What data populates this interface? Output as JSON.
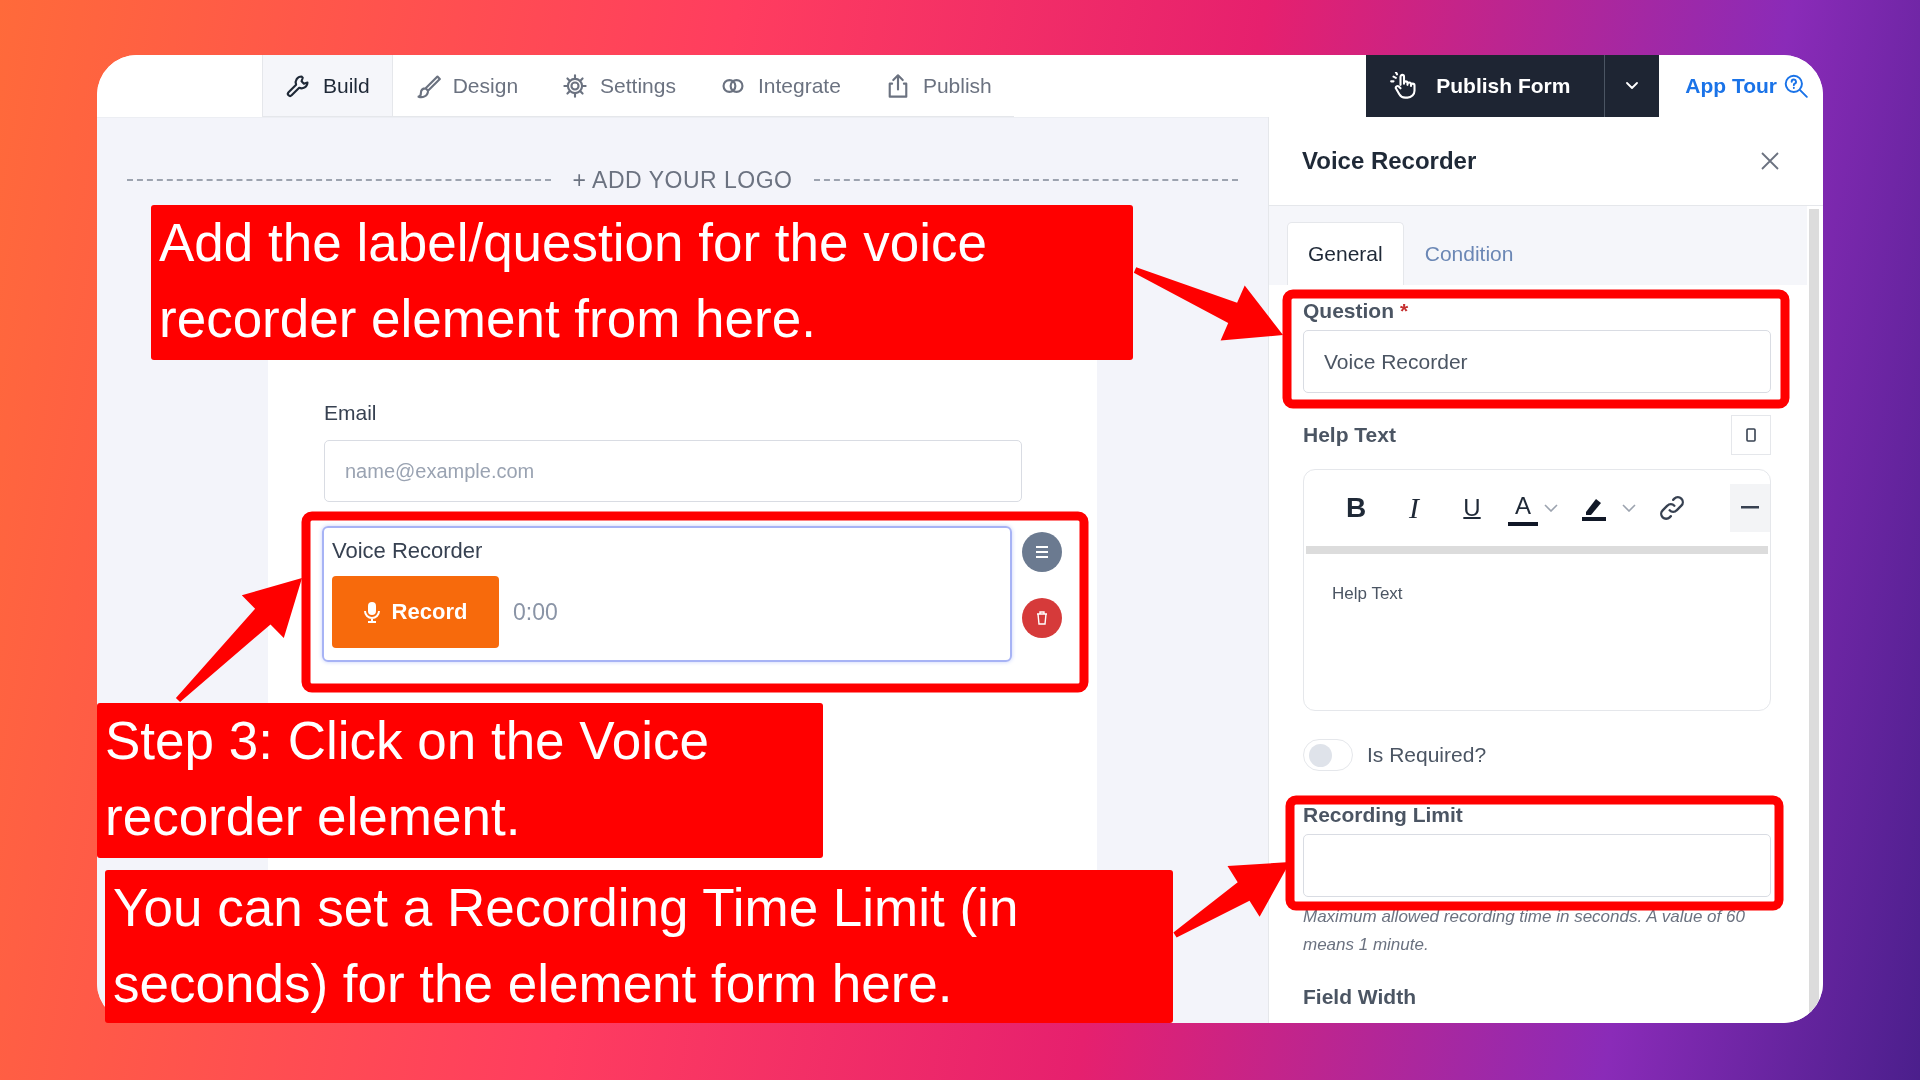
{
  "toolbar": {
    "tabs": [
      {
        "label": "Build",
        "kind": "wrench",
        "selected": true
      },
      {
        "label": "Design",
        "kind": "brush",
        "selected": false
      },
      {
        "label": "Settings",
        "kind": "gear",
        "selected": false
      },
      {
        "label": "Integrate",
        "kind": "link",
        "selected": false
      },
      {
        "label": "Publish",
        "kind": "share",
        "selected": false
      }
    ],
    "publish_button": "Publish Form",
    "app_tour": "App Tour"
  },
  "canvas": {
    "logo_placeholder": "+ ADD YOUR LOGO",
    "fields": [
      {
        "kind": "email",
        "label": "Email",
        "placeholder": "name@example.com",
        "selected": false
      },
      {
        "kind": "voice",
        "label": "Voice Recorder",
        "button": "Record",
        "time": "0:00",
        "selected": true
      }
    ]
  },
  "panel": {
    "title": "Voice Recorder",
    "tabs": [
      {
        "label": "General",
        "selected": true
      },
      {
        "label": "Condition",
        "selected": false
      }
    ],
    "question": {
      "label": "Question",
      "required_mark": "*",
      "value": "Voice Recorder"
    },
    "help_text": {
      "label": "Help Text",
      "placeholder": "Help Text",
      "format_buttons": [
        {
          "kind": "bold",
          "glyph": "B"
        },
        {
          "kind": "italic",
          "glyph": "I"
        },
        {
          "kind": "underline",
          "glyph": "U"
        },
        {
          "kind": "text-color",
          "glyph": "A"
        },
        {
          "kind": "highlight"
        },
        {
          "kind": "link"
        },
        {
          "kind": "more"
        }
      ]
    },
    "is_required": {
      "label": "Is Required?",
      "on": false
    },
    "recording_limit": {
      "label": "Recording Limit",
      "hint": "Maximum allowed recording time in seconds. A value of 60 means 1 minute."
    },
    "field_width_label": "Field Width"
  },
  "annotations": [
    {
      "text": "Add the label/question for the voice recorder element from here."
    },
    {
      "text": "Step 3: Click on the Voice recorder element."
    },
    {
      "text": "You can set a Recording Time Limit (in seconds) for the element form here."
    }
  ]
}
